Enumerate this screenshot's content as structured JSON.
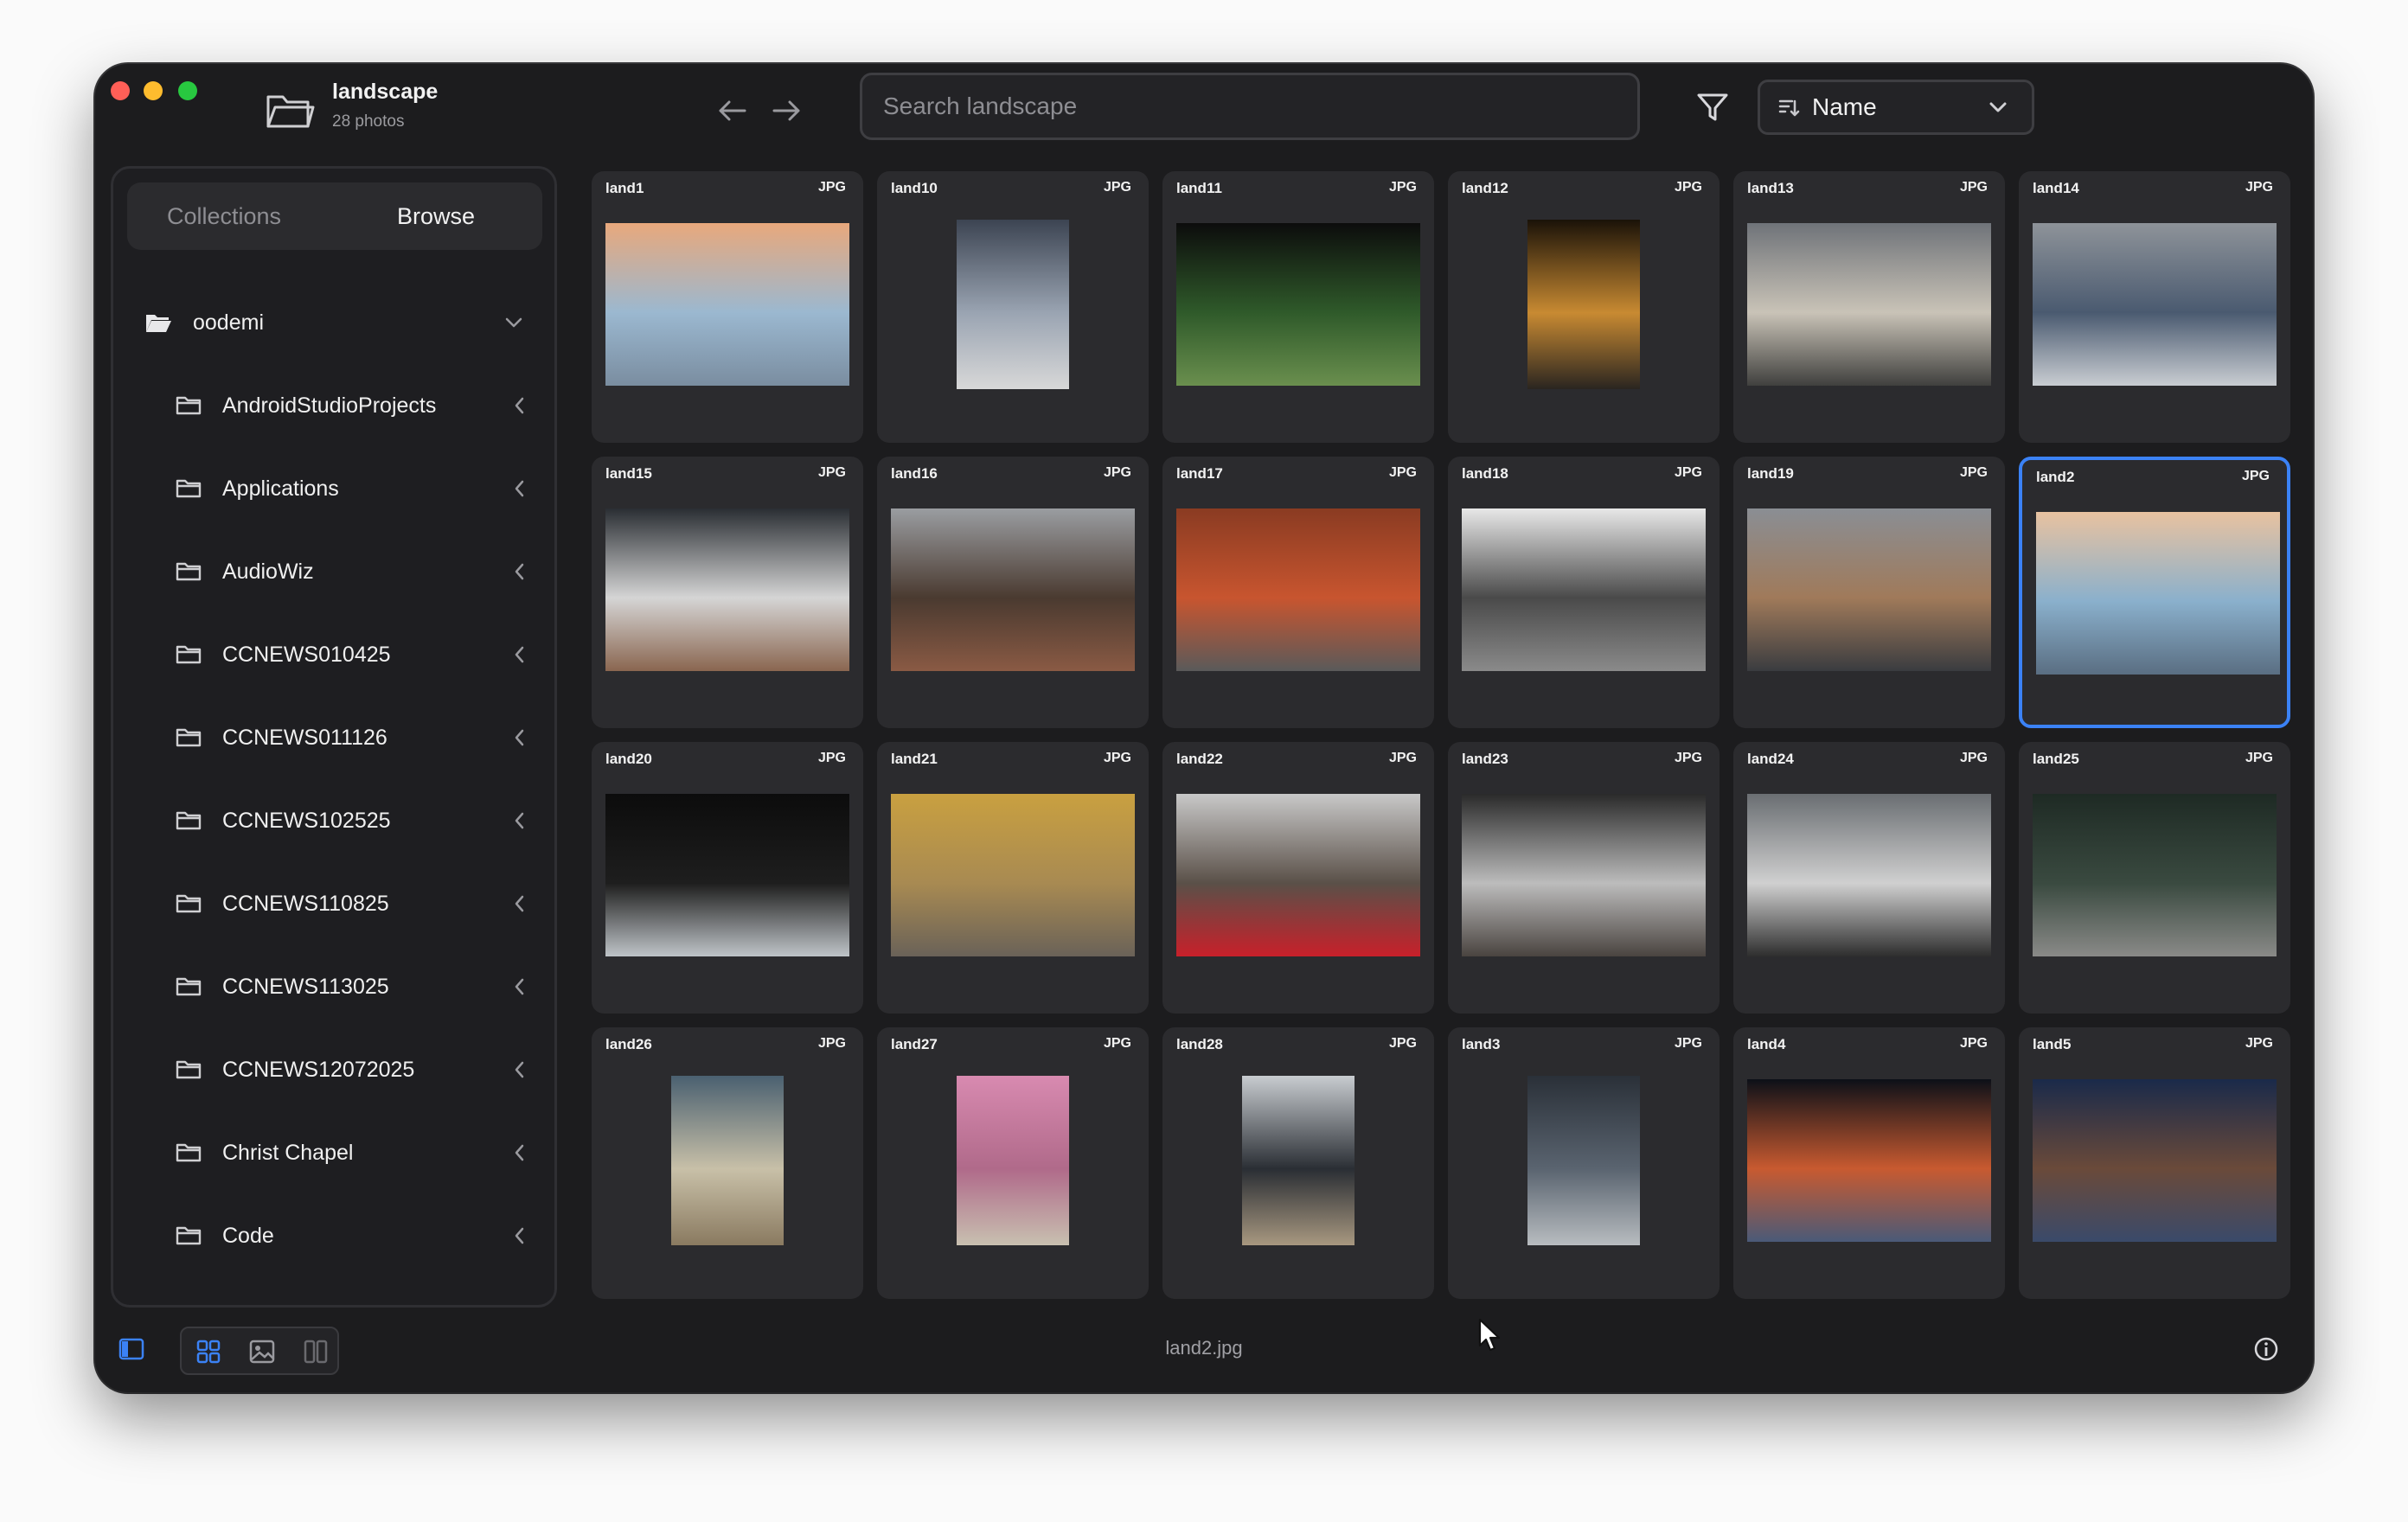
{
  "window": {
    "title": "landscape",
    "subtitle": "28 photos",
    "traffic_lights": {
      "close": "#ff5f57",
      "minimize": "#febc2e",
      "zoom": "#28c840"
    }
  },
  "toolbar": {
    "search_placeholder": "Search landscape",
    "sort_label": "Name",
    "icons": [
      "folder-icon",
      "back-arrow-icon",
      "forward-arrow-icon",
      "filter-icon",
      "sort-icon",
      "chevron-down-icon"
    ]
  },
  "sidebar": {
    "tabs": [
      {
        "label": "Collections",
        "active": false
      },
      {
        "label": "Browse",
        "active": true
      }
    ],
    "root": {
      "label": "oodemi",
      "expanded": true
    },
    "items": [
      {
        "label": "AndroidStudioProjects"
      },
      {
        "label": "Applications"
      },
      {
        "label": "AudioWiz"
      },
      {
        "label": "CCNEWS010425"
      },
      {
        "label": "CCNEWS011126"
      },
      {
        "label": "CCNEWS102525"
      },
      {
        "label": "CCNEWS110825"
      },
      {
        "label": "CCNEWS113025"
      },
      {
        "label": "CCNEWS12072025"
      },
      {
        "label": "Christ Chapel"
      },
      {
        "label": "Code"
      }
    ]
  },
  "photos": [
    {
      "name": "land1",
      "ext": "JPG",
      "orientation": "landscape",
      "colors": [
        "#e8a87c",
        "#9bb8d0",
        "#7a8da0"
      ]
    },
    {
      "name": "land10",
      "ext": "JPG",
      "orientation": "portrait",
      "colors": [
        "#3c4452",
        "#9aa4b2",
        "#d8d8d8"
      ]
    },
    {
      "name": "land11",
      "ext": "JPG",
      "orientation": "landscape",
      "colors": [
        "#0c0c0c",
        "#2f5a2a",
        "#6a8f4e"
      ]
    },
    {
      "name": "land12",
      "ext": "JPG",
      "orientation": "portrait",
      "colors": [
        "#1a1208",
        "#c88a32",
        "#2a2520"
      ]
    },
    {
      "name": "land13",
      "ext": "JPG",
      "orientation": "landscape",
      "colors": [
        "#6f7379",
        "#c9c3b7",
        "#40403e"
      ]
    },
    {
      "name": "land14",
      "ext": "JPG",
      "orientation": "landscape",
      "colors": [
        "#8e9399",
        "#4a5a70",
        "#c9cdd2"
      ]
    },
    {
      "name": "land15",
      "ext": "JPG",
      "orientation": "landscape",
      "colors": [
        "#2a2e33",
        "#d5d5d5",
        "#8a6650"
      ]
    },
    {
      "name": "land16",
      "ext": "JPG",
      "orientation": "landscape",
      "colors": [
        "#9a9da1",
        "#4a3a30",
        "#8a5a44"
      ]
    },
    {
      "name": "land17",
      "ext": "JPG",
      "orientation": "landscape",
      "colors": [
        "#8a3b22",
        "#c8552f",
        "#5a5a5a"
      ]
    },
    {
      "name": "land18",
      "ext": "JPG",
      "orientation": "landscape",
      "colors": [
        "#e8e8e8",
        "#4a4a4a",
        "#8a8a8a"
      ]
    },
    {
      "name": "land19",
      "ext": "JPG",
      "orientation": "landscape",
      "colors": [
        "#8a8e94",
        "#a07a5a",
        "#3a3c40"
      ]
    },
    {
      "name": "land2",
      "ext": "JPG",
      "orientation": "landscape",
      "selected": true,
      "colors": [
        "#e8c2a0",
        "#8ab0cc",
        "#5a6e82"
      ]
    },
    {
      "name": "land20",
      "ext": "JPG",
      "orientation": "landscape",
      "colors": [
        "#0c0c0c",
        "#1e1e1e",
        "#bfc4c8"
      ]
    },
    {
      "name": "land21",
      "ext": "JPG",
      "orientation": "landscape",
      "colors": [
        "#c9a040",
        "#a88a52",
        "#6a6258"
      ]
    },
    {
      "name": "land22",
      "ext": "JPG",
      "orientation": "landscape",
      "colors": [
        "#c8c8c8",
        "#5a5048",
        "#c8202a"
      ]
    },
    {
      "name": "land23",
      "ext": "JPG",
      "orientation": "landscape",
      "colors": [
        "#2a2a2a",
        "#bcbcbc",
        "#4a4440"
      ]
    },
    {
      "name": "land24",
      "ext": "JPG",
      "orientation": "landscape",
      "colors": [
        "#6a6e72",
        "#d0d0d0",
        "#2e2e2e"
      ]
    },
    {
      "name": "land25",
      "ext": "JPG",
      "orientation": "landscape",
      "colors": [
        "#1e2a24",
        "#3a4a40",
        "#8a8a88"
      ]
    },
    {
      "name": "land26",
      "ext": "JPG",
      "orientation": "portrait",
      "colors": [
        "#4a6070",
        "#c8c0a8",
        "#8a7a60"
      ]
    },
    {
      "name": "land27",
      "ext": "JPG",
      "orientation": "portrait",
      "colors": [
        "#d88ab0",
        "#b06a8a",
        "#c8c0b0"
      ]
    },
    {
      "name": "land28",
      "ext": "JPG",
      "orientation": "portrait",
      "colors": [
        "#c8ccd0",
        "#2a2e34",
        "#a89880"
      ]
    },
    {
      "name": "land3",
      "ext": "JPG",
      "orientation": "portrait",
      "colors": [
        "#2a3038",
        "#5a6470",
        "#b8bcc0"
      ]
    },
    {
      "name": "land4",
      "ext": "JPG",
      "orientation": "landscape",
      "colors": [
        "#0c1018",
        "#c85a30",
        "#4a5a78"
      ]
    },
    {
      "name": "land5",
      "ext": "JPG",
      "orientation": "landscape",
      "colors": [
        "#1a2a4a",
        "#6a4a3a",
        "#3a4a6a"
      ]
    }
  ],
  "statusbar": {
    "filename": "land2.jpg",
    "icons": [
      "sidebar-toggle-icon",
      "grid-view-icon",
      "single-image-view-icon",
      "split-view-icon",
      "info-icon"
    ]
  },
  "colors": {
    "accent": "#3b82f6",
    "background": "#1c1c1e",
    "card": "#2b2b2e"
  }
}
